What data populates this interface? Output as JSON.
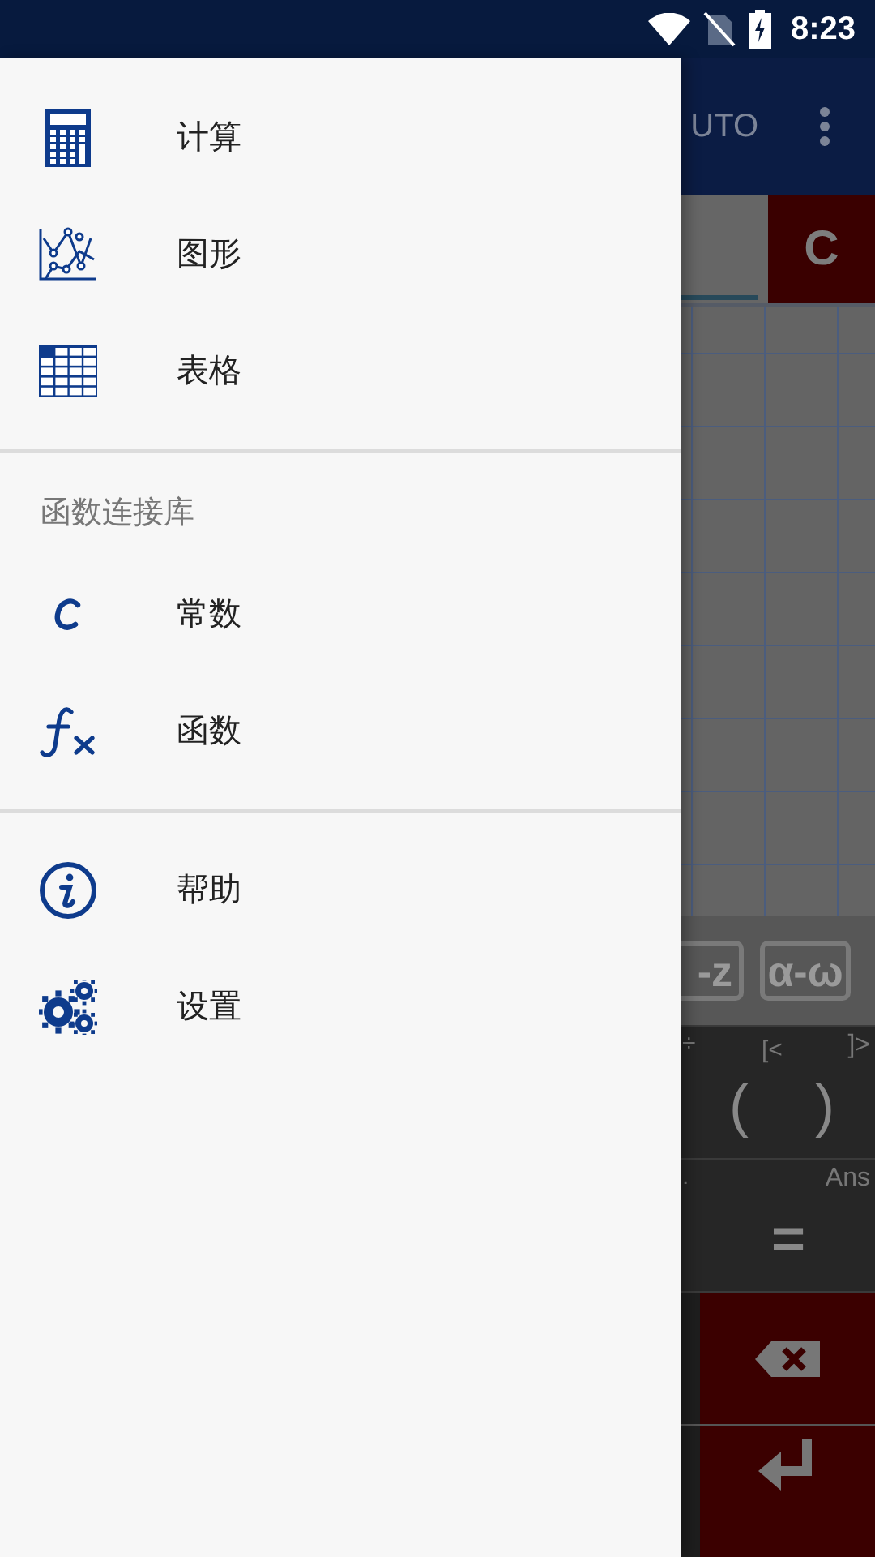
{
  "status_bar": {
    "time": "8:23"
  },
  "app": {
    "toolbar_title": "UTO",
    "clear_key": "C",
    "mode_keys": [
      "-z",
      "α-ω"
    ],
    "key_rows": [
      {
        "small_left": "÷",
        "small_mid": "[<",
        "small_right": "]>",
        "main_left": "(",
        "main_right": ")"
      },
      {
        "small_left": ".",
        "small_right": "Ans",
        "main_right": "="
      }
    ]
  },
  "drawer": {
    "sections": [
      {
        "items": [
          {
            "label": "计算"
          },
          {
            "label": "图形"
          },
          {
            "label": "表格"
          }
        ]
      },
      {
        "header": "函数连接库",
        "items": [
          {
            "label": "常数"
          },
          {
            "label": "函数"
          }
        ]
      },
      {
        "items": [
          {
            "label": "帮助"
          },
          {
            "label": "设置"
          }
        ]
      }
    ]
  }
}
